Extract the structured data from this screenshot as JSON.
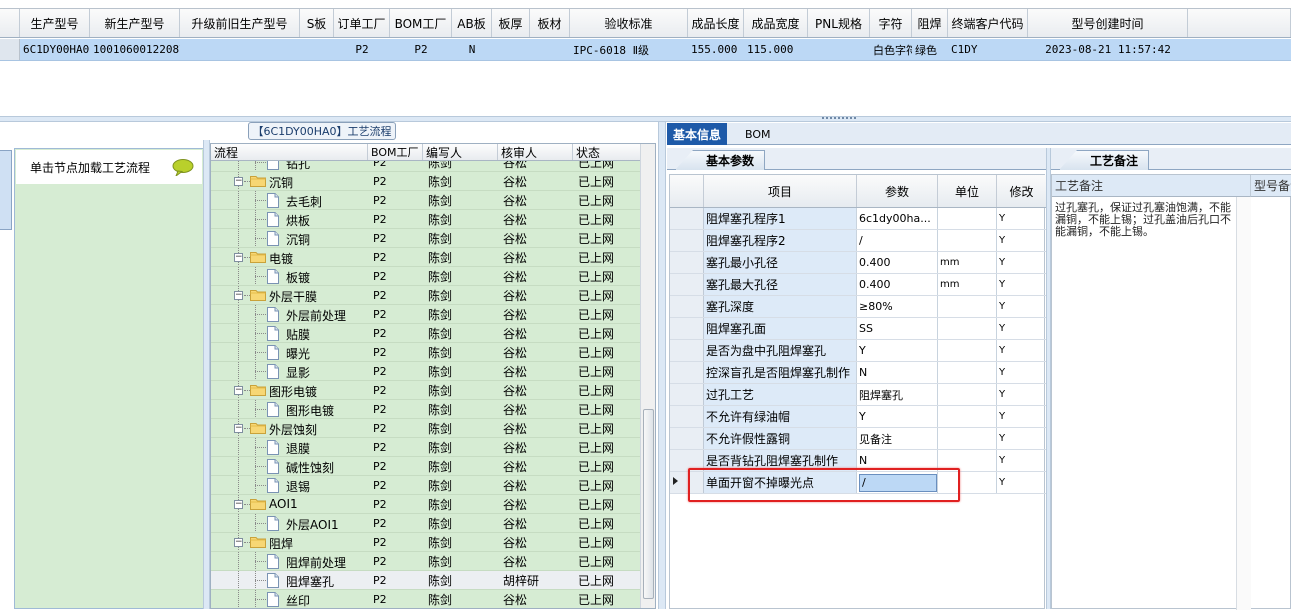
{
  "top_grid": {
    "columns": [
      "",
      "生产型号",
      "新生产型号",
      "升级前旧生产型号",
      "S板",
      "订单工厂",
      "BOM工厂",
      "AB板",
      "板厚",
      "板材",
      "验收标准",
      "成品长度",
      "成品宽度",
      "PNL规格",
      "字符",
      "阻焊",
      "终端客户代码",
      "型号创建时间"
    ],
    "row": [
      "",
      "6C1DY00HA0",
      "10010600122087",
      "",
      "",
      "P2",
      "P2",
      "N",
      "",
      "",
      "IPC-6018 Ⅱ级",
      "155.000",
      "115.000",
      "",
      "白色字符",
      "绿色",
      "C1DY",
      "2023-08-21 11:57:42"
    ]
  },
  "left_nav": {
    "title": "单击节点加载工艺流程",
    "icon": "speech-bubble-icon",
    "accent": "#d6ecd3"
  },
  "tree": {
    "caption": "【6C1DY00HA0】工艺流程",
    "columns": [
      "流程",
      "BOM工厂",
      "编写人",
      "核审人",
      "状态"
    ],
    "rows": [
      {
        "name": "钻孔",
        "level": 2,
        "type": "doc",
        "factory": "P2",
        "writer": "陈剑",
        "reviewer": "谷松",
        "status": "已上网"
      },
      {
        "name": "沉铜",
        "level": 1,
        "type": "folder",
        "factory": "P2",
        "writer": "陈剑",
        "reviewer": "谷松",
        "status": "已上网"
      },
      {
        "name": "去毛刺",
        "level": 2,
        "type": "doc",
        "factory": "P2",
        "writer": "陈剑",
        "reviewer": "谷松",
        "status": "已上网"
      },
      {
        "name": "烘板",
        "level": 2,
        "type": "doc",
        "factory": "P2",
        "writer": "陈剑",
        "reviewer": "谷松",
        "status": "已上网"
      },
      {
        "name": "沉铜",
        "level": 2,
        "type": "doc",
        "factory": "P2",
        "writer": "陈剑",
        "reviewer": "谷松",
        "status": "已上网"
      },
      {
        "name": "电镀",
        "level": 1,
        "type": "folder",
        "factory": "P2",
        "writer": "陈剑",
        "reviewer": "谷松",
        "status": "已上网"
      },
      {
        "name": "板镀",
        "level": 2,
        "type": "doc",
        "factory": "P2",
        "writer": "陈剑",
        "reviewer": "谷松",
        "status": "已上网"
      },
      {
        "name": "外层干膜",
        "level": 1,
        "type": "folder",
        "factory": "P2",
        "writer": "陈剑",
        "reviewer": "谷松",
        "status": "已上网"
      },
      {
        "name": "外层前处理",
        "level": 2,
        "type": "doc",
        "factory": "P2",
        "writer": "陈剑",
        "reviewer": "谷松",
        "status": "已上网"
      },
      {
        "name": "贴膜",
        "level": 2,
        "type": "doc",
        "factory": "P2",
        "writer": "陈剑",
        "reviewer": "谷松",
        "status": "已上网"
      },
      {
        "name": "曝光",
        "level": 2,
        "type": "doc",
        "factory": "P2",
        "writer": "陈剑",
        "reviewer": "谷松",
        "status": "已上网"
      },
      {
        "name": "显影",
        "level": 2,
        "type": "doc",
        "factory": "P2",
        "writer": "陈剑",
        "reviewer": "谷松",
        "status": "已上网"
      },
      {
        "name": "图形电镀",
        "level": 1,
        "type": "folder",
        "factory": "P2",
        "writer": "陈剑",
        "reviewer": "谷松",
        "status": "已上网"
      },
      {
        "name": "图形电镀",
        "level": 2,
        "type": "doc",
        "factory": "P2",
        "writer": "陈剑",
        "reviewer": "谷松",
        "status": "已上网"
      },
      {
        "name": "外层蚀刻",
        "level": 1,
        "type": "folder",
        "factory": "P2",
        "writer": "陈剑",
        "reviewer": "谷松",
        "status": "已上网"
      },
      {
        "name": "退膜",
        "level": 2,
        "type": "doc",
        "factory": "P2",
        "writer": "陈剑",
        "reviewer": "谷松",
        "status": "已上网"
      },
      {
        "name": "碱性蚀刻",
        "level": 2,
        "type": "doc",
        "factory": "P2",
        "writer": "陈剑",
        "reviewer": "谷松",
        "status": "已上网"
      },
      {
        "name": "退锡",
        "level": 2,
        "type": "doc",
        "factory": "P2",
        "writer": "陈剑",
        "reviewer": "谷松",
        "status": "已上网"
      },
      {
        "name": "AOI1",
        "level": 1,
        "type": "folder",
        "factory": "P2",
        "writer": "陈剑",
        "reviewer": "谷松",
        "status": "已上网"
      },
      {
        "name": "外层AOI1",
        "level": 2,
        "type": "doc",
        "factory": "P2",
        "writer": "陈剑",
        "reviewer": "谷松",
        "status": "已上网"
      },
      {
        "name": "阻焊",
        "level": 1,
        "type": "folder",
        "factory": "P2",
        "writer": "陈剑",
        "reviewer": "谷松",
        "status": "已上网"
      },
      {
        "name": "阻焊前处理",
        "level": 2,
        "type": "doc",
        "factory": "P2",
        "writer": "陈剑",
        "reviewer": "谷松",
        "status": "已上网"
      },
      {
        "name": "阻焊塞孔",
        "level": 2,
        "type": "doc",
        "factory": "P2",
        "writer": "陈剑",
        "reviewer": "胡梓研",
        "status": "已上网",
        "selected": true
      },
      {
        "name": "丝印",
        "level": 2,
        "type": "doc",
        "factory": "P2",
        "writer": "陈剑",
        "reviewer": "谷松",
        "status": "已上网"
      }
    ]
  },
  "info_tabs": [
    "基本信息",
    "BOM"
  ],
  "basic_params": {
    "tab": "基本参数",
    "columns": [
      "项目",
      "参数",
      "单位",
      "修改"
    ],
    "rows": [
      {
        "item": "阻焊塞孔程序1",
        "value": "6c1dy00ha...",
        "unit": "",
        "mod": "Y"
      },
      {
        "item": "阻焊塞孔程序2",
        "value": "/",
        "unit": "",
        "mod": "Y"
      },
      {
        "item": "塞孔最小孔径",
        "value": "0.400",
        "unit": "mm",
        "mod": "Y"
      },
      {
        "item": "塞孔最大孔径",
        "value": "0.400",
        "unit": "mm",
        "mod": "Y"
      },
      {
        "item": "塞孔深度",
        "value": "≥80%",
        "unit": "",
        "mod": "Y"
      },
      {
        "item": "阻焊塞孔面",
        "value": "SS",
        "unit": "",
        "mod": "Y"
      },
      {
        "item": "是否为盘中孔阻焊塞孔",
        "value": "Y",
        "unit": "",
        "mod": "Y"
      },
      {
        "item": "控深盲孔是否阻焊塞孔制作",
        "value": "N",
        "unit": "",
        "mod": "Y"
      },
      {
        "item": "过孔工艺",
        "value": "阻焊塞孔",
        "unit": "",
        "mod": "Y"
      },
      {
        "item": "不允许有绿油帽",
        "value": "Y",
        "unit": "",
        "mod": "Y"
      },
      {
        "item": "不允许假性露铜",
        "value": "见备注",
        "unit": "",
        "mod": "Y"
      },
      {
        "item": "是否背钻孔阻焊塞孔制作",
        "value": "N",
        "unit": "",
        "mod": "Y"
      },
      {
        "item": "单面开窗不掉曝光点",
        "value": "/",
        "unit": "",
        "mod": "Y",
        "current": true
      }
    ]
  },
  "remark": {
    "tab": "工艺备注",
    "col1": "工艺备注",
    "col2": "型号备注",
    "text": "过孔塞孔，保证过孔塞油饱满，不能漏铜，不能上锡；过孔盖油后孔口不能漏铜，不能上锡。"
  },
  "colors": {
    "tree_bg": "#d6ecd3",
    "selection": "#bcd8f5",
    "highlight_border": "#e02020",
    "tab_active": "#1e5aa8"
  }
}
